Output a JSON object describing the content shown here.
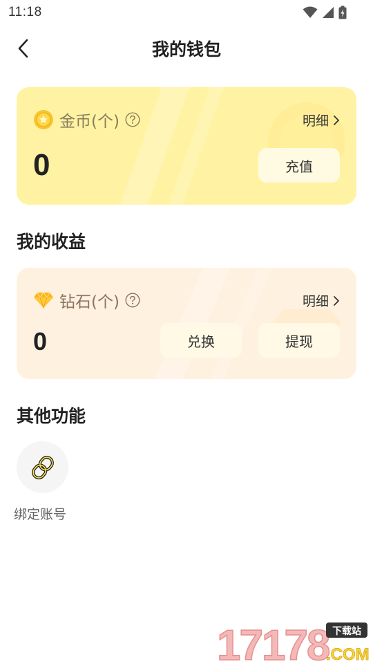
{
  "status_bar": {
    "time": "11:18"
  },
  "header": {
    "title": "我的钱包"
  },
  "gold_card": {
    "label": "金币(个)",
    "detail_label": "明细",
    "amount": "0",
    "recharge_label": "充值",
    "accent": "#fff3a3"
  },
  "earnings": {
    "section_title": "我的收益",
    "label": "钻石(个)",
    "detail_label": "明细",
    "amount": "0",
    "exchange_label": "兑换",
    "withdraw_label": "提现",
    "accent": "#fff1df"
  },
  "other": {
    "section_title": "其他功能",
    "features": [
      {
        "label": "绑定账号",
        "icon": "link-icon"
      }
    ]
  },
  "watermark": {
    "text": "17178",
    "badge": "下载站",
    "suffix": ".COM"
  }
}
